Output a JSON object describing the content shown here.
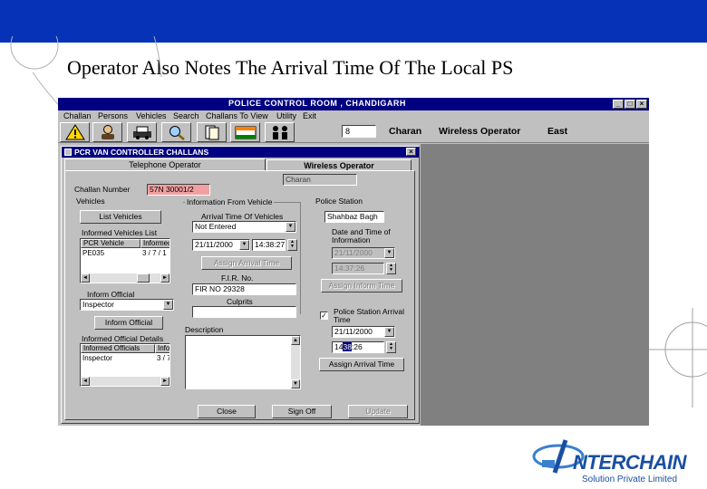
{
  "slide": {
    "title": "Operator Also Notes The Arrival Time Of The Local PS",
    "logo": {
      "name": "NTERCHAIN",
      "tagline": "Solution Private Limited"
    },
    "accent_color": "#0632b8"
  },
  "app": {
    "title": "POLICE CONTROL ROOM , CHANDIGARH",
    "window_controls": {
      "minimize": "_",
      "maximize": "□",
      "close": "×"
    },
    "menu": [
      "Challan",
      "Persons",
      "Vehicles",
      "Search",
      "Challans To View",
      "Utility",
      "Exit"
    ],
    "toolbar": {
      "icons": [
        "warning-icon",
        "person-icon",
        "vehicle-icon",
        "search-icon",
        "documents-icon",
        "map-icon",
        "officers-icon"
      ],
      "operator_id": "8",
      "operator_name": "Charan",
      "operator_role": "Wireless Operator",
      "zone": "East"
    }
  },
  "form": {
    "title": "PCR VAN CONTROLLER CHALLANS",
    "tabs": {
      "telephone": "Telephone Operator",
      "wireless": "Wireless Operator"
    },
    "operator_value": "Charan",
    "challan_label": "Challan Number",
    "challan_number": "57N 30001/2",
    "vehicles": {
      "caption": "Vehicles",
      "list_button": "List Vehicles",
      "informed_label": "Informed Vehicles List",
      "columns": [
        "PCR Vehicle",
        "Informed"
      ],
      "rows": [
        {
          "vehicle": "PE035",
          "informed": "3 / 7 / 1"
        }
      ]
    },
    "officials": {
      "label": "Inform Official",
      "value": "Inspector",
      "button": "Inform Official",
      "details_label": "Informed Official Details",
      "columns": [
        "Informed Officials",
        "Inform"
      ],
      "rows": [
        {
          "official": "Inspector",
          "informed": "3 / 7"
        }
      ]
    },
    "from_vehicle": {
      "caption": "Information From Vehicle",
      "arrival_label": "Arrival Time Of Vehicles",
      "arrival_value": "Not Entered",
      "date": "21/11/2000",
      "time": "14:38:27",
      "assign_button": "Assign Arrival Time",
      "fir_label": "F.I.R. No.",
      "fir_value": "FIR NO 29328",
      "culprits_label": "Culprits",
      "culprits_value": ""
    },
    "description": {
      "label": "Description",
      "value": ""
    },
    "police_station": {
      "caption": "Police Station",
      "station": "Shahbaz Bagh",
      "info_label": "Date and Time of Information",
      "date": "21/11/2000",
      "time": "14:37:26",
      "inform_button": "Assign Inform Time",
      "arrival_check_label": "Police Station Arrival Time",
      "arrival_checked": "✓",
      "arrival_date": "21/11/2000",
      "arrival_time_h": "14",
      "arrival_time_sel": "38",
      "arrival_time_s": ":26",
      "assign_button": "Assign Arrival Time"
    },
    "buttons": {
      "close": "Close",
      "sign_off": "Sign Off",
      "update": "Update"
    }
  }
}
